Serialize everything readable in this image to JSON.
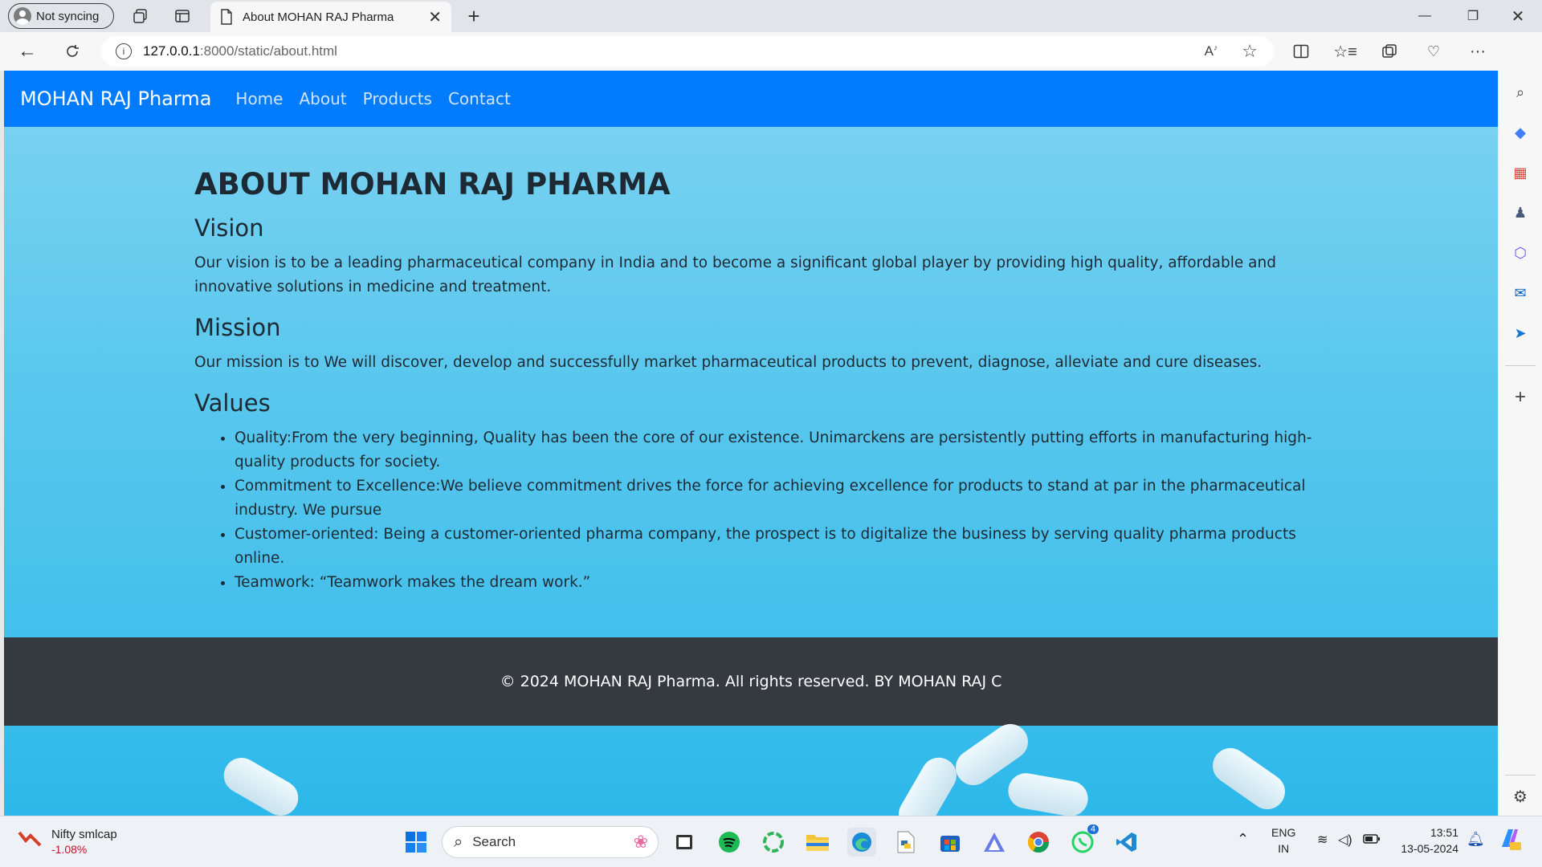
{
  "browser": {
    "profile_label": "Not syncing",
    "tab_title": "About MOHAN RAJ Pharma",
    "url_host": "127.0.0.1",
    "url_path": ":8000/static/about.html"
  },
  "site": {
    "brand": "MOHAN RAJ Pharma",
    "nav": [
      {
        "label": "Home"
      },
      {
        "label": "About"
      },
      {
        "label": "Products"
      },
      {
        "label": "Contact"
      }
    ],
    "heading": "ABOUT MOHAN RAJ PHARMA",
    "vision_title": "Vision",
    "vision_text": "Our vision is to be a leading pharmaceutical company in India and to become a significant global player by providing high quality, affordable and innovative solutions in medicine and treatment.",
    "mission_title": "Mission",
    "mission_text": "Our mission is to We will discover, develop and successfully market pharmaceutical products to prevent, diagnose, alleviate and cure diseases.",
    "values_title": "Values",
    "values": [
      "Quality:From the very beginning, Quality has been the core of our existence. Unimarckens are persistently putting efforts in manufacturing high-quality products for society.",
      "Commitment to Excellence:We believe commitment drives the force for achieving excellence for products to stand at par in the pharmaceutical industry. We pursue",
      "Customer-oriented: Being a customer-oriented pharma company, the prospect is to digitalize the business by serving quality pharma products online.",
      "Teamwork: “Teamwork makes the dream work.”"
    ],
    "footer": "© 2024 MOHAN RAJ Pharma. All rights reserved. BY MOHAN RAJ C"
  },
  "taskbar": {
    "widget_title": "Nifty smlcap",
    "widget_value": "-1.08%",
    "search_label": "Search",
    "whatsapp_badge": "4",
    "lang_top": "ENG",
    "lang_bottom": "IN",
    "time": "13:51",
    "date": "13-05-2024"
  },
  "colors": {
    "navbar": "#037bfd",
    "footer": "#343a40",
    "page_bg": "#5bc8ee"
  }
}
